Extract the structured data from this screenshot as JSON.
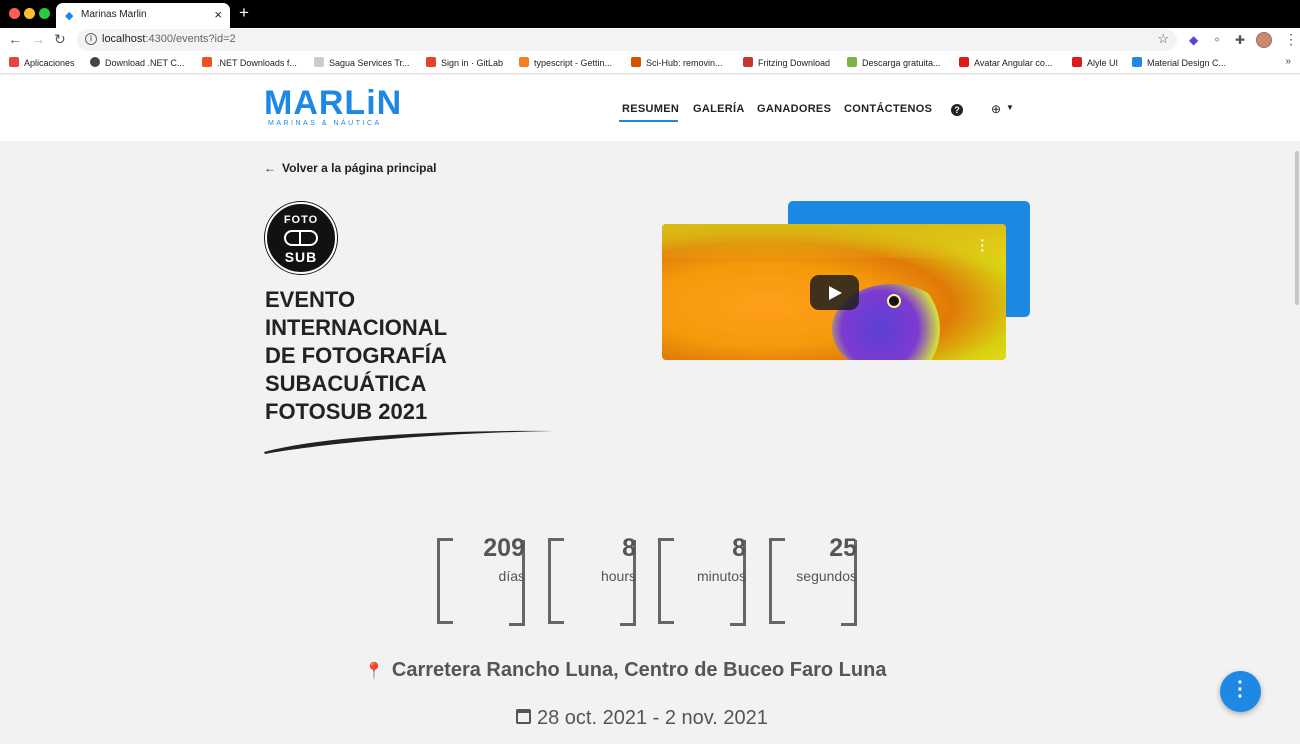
{
  "browser": {
    "tab_title": "Marinas Marlin",
    "new_tab": "+",
    "url_host": "localhost",
    "url_rest": ":4300/events?id=2",
    "bookmarks": [
      {
        "label": "Aplicaciones",
        "color": "#e8453c"
      },
      {
        "label": "Download .NET C...",
        "color": "#444"
      },
      {
        "label": ".NET Downloads f...",
        "color": "#f25022"
      },
      {
        "label": "Sagua Services Tr...",
        "color": "#999"
      },
      {
        "label": "Sign in · GitLab",
        "color": "#e24329"
      },
      {
        "label": "typescript - Gettin...",
        "color": "#f48024"
      },
      {
        "label": "Sci-Hub: removin...",
        "color": "#d35400"
      },
      {
        "label": "Fritzing Download",
        "color": "#c0392b"
      },
      {
        "label": "Descarga gratuita...",
        "color": "#7cb342"
      },
      {
        "label": "Avatar Angular co...",
        "color": "#dd1b16"
      },
      {
        "label": "Alyle UI",
        "color": "#dd1b16"
      },
      {
        "label": "Material Design C...",
        "color": "#1e88e5"
      }
    ],
    "more": "»"
  },
  "header": {
    "logo_text": "MARLiN",
    "logo_sub": "MARINAS & NÁUTICA",
    "nav": [
      "RESUMEN",
      "GALERÍA",
      "GANADORES",
      "CONTÁCTENOS"
    ],
    "help": "?"
  },
  "main": {
    "back_label": "Volver a la página principal",
    "fotosub_top": "FOTO",
    "fotosub_bottom": "SUB",
    "title_lines": [
      "EVENTO",
      "INTERNACIONAL",
      "DE FOTOGRAFÍA",
      "SUBACUÁTICA",
      "FOTOSUB 2021"
    ],
    "countdown": [
      {
        "value": "209",
        "label": "días"
      },
      {
        "value": "8",
        "label": "hours"
      },
      {
        "value": "8",
        "label": "minutos"
      },
      {
        "value": "25",
        "label": "segundos"
      }
    ],
    "location": "Carretera Rancho Luna, Centro de Buceo Faro Luna",
    "dates": "28 oct. 2021 - 2 nov. 2021"
  },
  "colors": {
    "accent": "#1e88e5",
    "text": "#555555"
  }
}
